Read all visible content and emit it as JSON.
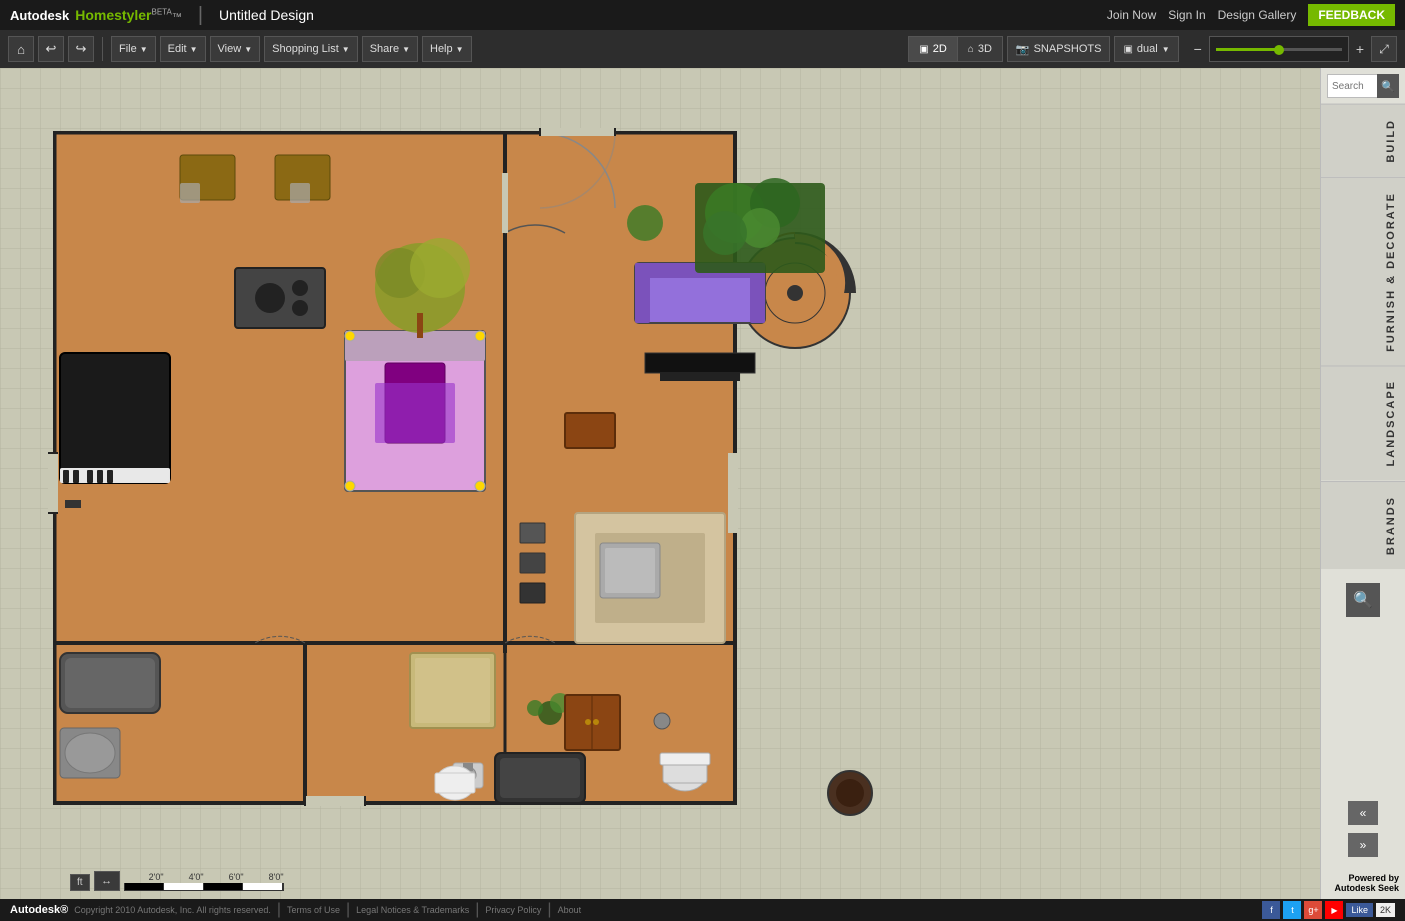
{
  "app": {
    "brand": "Autodesk",
    "product": "Homestyler",
    "beta_label": "BETA",
    "logo_separator": "|",
    "design_title": "Untitled Design"
  },
  "top_nav": {
    "join_now": "Join Now",
    "sign_in": "Sign In",
    "design_gallery": "Design Gallery",
    "feedback": "FEEDBACK"
  },
  "toolbar": {
    "home_icon": "⌂",
    "undo_icon": "↩",
    "redo_icon": "↪",
    "file_label": "File",
    "edit_label": "Edit",
    "view_label": "View",
    "shopping_list_label": "Shopping List",
    "share_label": "Share",
    "help_label": "Help",
    "mode_2d": "2D",
    "mode_3d": "3D",
    "snapshots": "SNAPSHOTS",
    "dual": "dual",
    "zoom_minus": "−",
    "zoom_plus": "+",
    "fullscreen": "⤢"
  },
  "right_sidebar": {
    "search_placeholder": "Search",
    "search_go": "🔍",
    "tabs": [
      {
        "id": "build",
        "label": "BUILD"
      },
      {
        "id": "furnish",
        "label": "FURNISH & DECORATE"
      },
      {
        "id": "landscape",
        "label": "LANDSCAPE"
      },
      {
        "id": "brands",
        "label": "BRANDS"
      }
    ],
    "collapse_up": "«",
    "collapse_down": "»",
    "powered_by_prefix": "Powered by ",
    "powered_by_brand": "Autodesk",
    "powered_by_suffix": " Seek"
  },
  "bottom_bar": {
    "unit": "ft",
    "measure_icon": "↔",
    "scale_marks": [
      "",
      "2'0\"",
      "4'0\"",
      "6'0\"",
      "8'0\""
    ]
  },
  "footer": {
    "logo": "Autodesk®",
    "copyright": "Copyright 2010 Autodesk, Inc. All rights reserved.",
    "terms": "Terms of Use",
    "legal": "Legal Notices & Trademarks",
    "privacy": "Privacy Policy",
    "about": "About",
    "separator": "|",
    "like": "Like",
    "like_count": "2K"
  }
}
